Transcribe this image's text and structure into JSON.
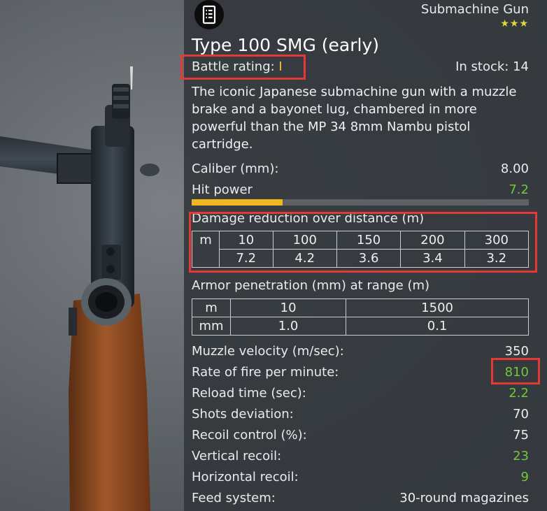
{
  "weapon": {
    "class": "Submachine Gun",
    "rank_stars": "★★★",
    "name": "Type 100 SMG (early)",
    "battle_rating_label": "Battle rating:",
    "battle_rating_value": "I",
    "in_stock_label": "In stock:",
    "in_stock_value": "14",
    "description": "The iconic Japanese submachine gun with a muzzle brake and a bayonet lug, chambered in more powerful than the MP 34 8mm Nambu pistol cartridge."
  },
  "stats": {
    "caliber_label": "Caliber (mm):",
    "caliber_value": "8.00",
    "hit_power_label": "Hit power",
    "hit_power_value": "7.2",
    "hit_power_fill": 0.27
  },
  "damage_table": {
    "title": "Damage reduction over distance (m)",
    "row_label": "m",
    "columns": [
      {
        "distance": "10",
        "damage": "7.2"
      },
      {
        "distance": "100",
        "damage": "4.2"
      },
      {
        "distance": "150",
        "damage": "3.6"
      },
      {
        "distance": "200",
        "damage": "3.4"
      },
      {
        "distance": "300",
        "damage": "3.2"
      }
    ]
  },
  "armor_table": {
    "title": "Armor penetration (mm) at range (m)",
    "row_label_1": "m",
    "row_label_2": "mm",
    "columns": [
      {
        "range": "10",
        "penetration": "1.0"
      },
      {
        "range": "1500",
        "penetration": "0.1"
      }
    ]
  },
  "specs": [
    {
      "label": "Muzzle velocity (m/sec):",
      "value": "350",
      "color": "#eceef0"
    },
    {
      "label": "Rate of fire per minute:",
      "value": "810",
      "color": "#72c83b"
    },
    {
      "label": "Reload time (sec):",
      "value": "2.2",
      "color": "#72c83b"
    },
    {
      "label": "Shots deviation:",
      "value": "70",
      "color": "#eceef0"
    },
    {
      "label": "Recoil control (%):",
      "value": "75",
      "color": "#eceef0"
    },
    {
      "label": "Vertical recoil:",
      "value": "23",
      "color": "#72c83b"
    },
    {
      "label": "Horizontal recoil:",
      "value": "9",
      "color": "#72c83b"
    },
    {
      "label": "Feed system:",
      "value": "30-round magazines",
      "color": "#eceef0"
    }
  ],
  "colors": {
    "accent_green": "#72c83b",
    "bar_yellow": "#f0b81e",
    "highlight_red": "#e53935",
    "star_yellow": "#e1da3e"
  },
  "icons": {
    "weapon_type": "document-list-icon"
  }
}
